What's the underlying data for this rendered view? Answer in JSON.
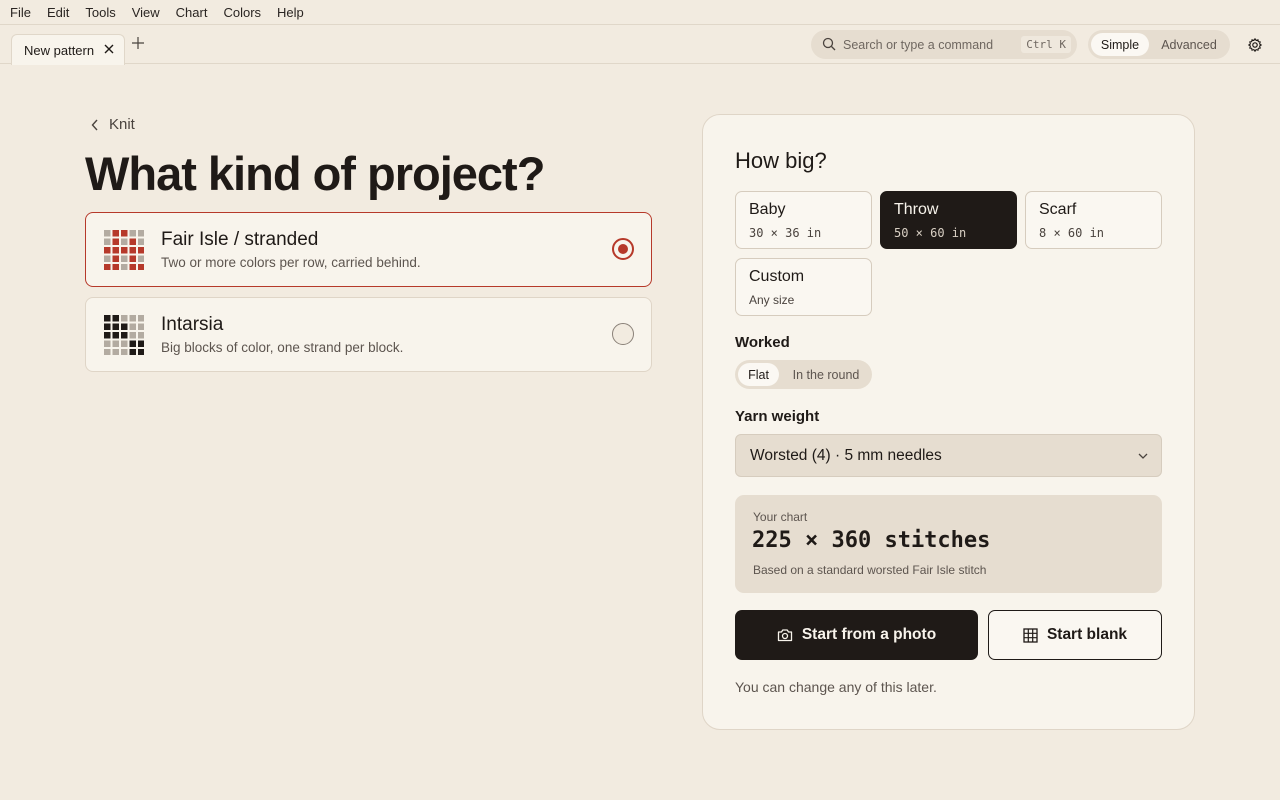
{
  "menu": [
    "File",
    "Edit",
    "Tools",
    "View",
    "Chart",
    "Colors",
    "Help"
  ],
  "tab": {
    "label": "New pattern"
  },
  "search": {
    "placeholder": "Search or type a command",
    "shortcut": "Ctrl K"
  },
  "mode": {
    "options": [
      "Simple",
      "Advanced"
    ],
    "selected": "Simple"
  },
  "breadcrumb": {
    "back_label": "Knit"
  },
  "page_title": "What kind of project?",
  "projects": [
    {
      "title": "Fair Isle / stranded",
      "description": "Two or more colors per row, carried behind.",
      "selected": true,
      "icon": "fair-isle-grid-icon"
    },
    {
      "title": "Intarsia",
      "description": "Big blocks of color, one strand per block.",
      "selected": false,
      "icon": "intarsia-grid-icon"
    }
  ],
  "size": {
    "heading": "How big?",
    "options": [
      {
        "name": "Baby",
        "dims": "30 × 36 in"
      },
      {
        "name": "Throw",
        "dims": "50 × 60 in"
      },
      {
        "name": "Scarf",
        "dims": "8 × 60 in"
      },
      {
        "name": "Custom",
        "dims": "Any size"
      }
    ],
    "selected": "Throw"
  },
  "worked": {
    "label": "Worked",
    "options": [
      "Flat",
      "In the round"
    ],
    "selected": "Flat"
  },
  "yarn": {
    "label": "Yarn weight",
    "value": "Worsted (4) · 5 mm needles"
  },
  "summary": {
    "label": "Your chart",
    "value": "225 × 360 stitches",
    "note": "Based on a standard worsted Fair Isle stitch"
  },
  "actions": {
    "photo_label": "Start from a photo",
    "blank_label": "Start blank"
  },
  "footnote": "You can change any of this later.",
  "colors": {
    "accent": "#b6392a",
    "dark": "#1f1a17",
    "background": "#f2ebe0",
    "card": "#f8f4ec",
    "grey_cell": "#b3aba1"
  }
}
